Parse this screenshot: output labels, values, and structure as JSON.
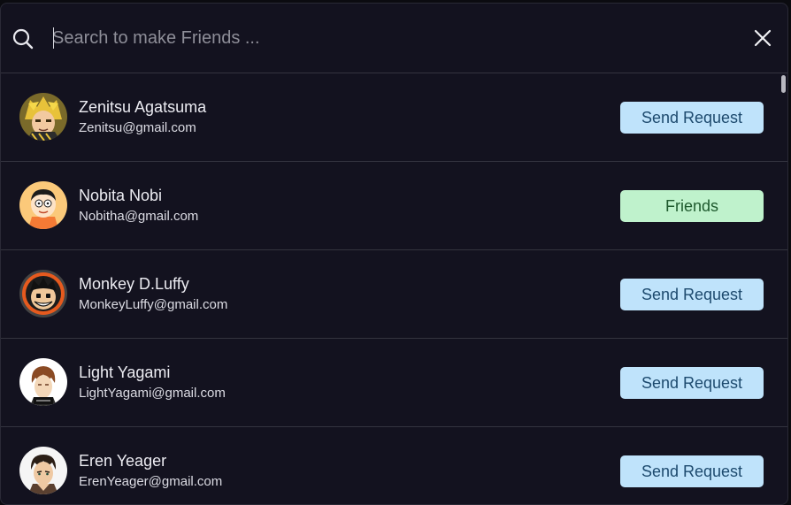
{
  "search": {
    "placeholder": "Search to make Friends ...",
    "value": ""
  },
  "icons": {
    "search": "search-icon",
    "close": "close-icon"
  },
  "colors": {
    "background": "#13121f",
    "divider": "#34343f",
    "send_request_bg": "#bfe3fb",
    "send_request_text": "#1d4a6e",
    "friends_bg": "#bff2cc",
    "friends_text": "#1f5a2e"
  },
  "users": [
    {
      "name": "Zenitsu Agatsuma",
      "email": "Zenitsu@gmail.com",
      "action": "Send Request",
      "status": "request"
    },
    {
      "name": "Nobita Nobi",
      "email": "Nobitha@gmail.com",
      "action": "Friends",
      "status": "friends"
    },
    {
      "name": "Monkey D.Luffy",
      "email": "MonkeyLuffy@gmail.com",
      "action": "Send Request",
      "status": "request"
    },
    {
      "name": "Light Yagami",
      "email": "LightYagami@gmail.com",
      "action": "Send Request",
      "status": "request"
    },
    {
      "name": "Eren Yeager",
      "email": "ErenYeager@gmail.com",
      "action": "Send Request",
      "status": "request"
    }
  ]
}
